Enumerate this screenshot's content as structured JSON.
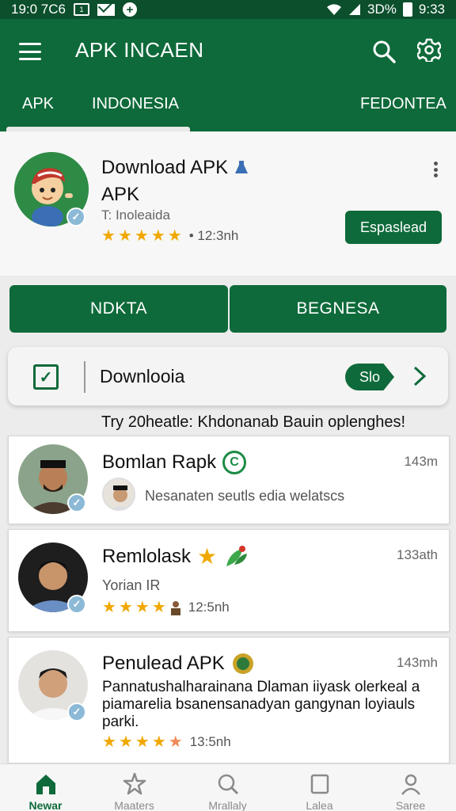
{
  "statusbar": {
    "left_text": "19:0 7C6",
    "box_label": "1",
    "signal_text": "3D%",
    "time": "9:33"
  },
  "appbar": {
    "title": "APK INCAEN",
    "tabs": [
      {
        "label": "APK"
      },
      {
        "label": "INDONESIA"
      },
      {
        "label": "FEDONTEA"
      }
    ]
  },
  "featured": {
    "title": "Download APK",
    "subtitle": "APK",
    "developer": "T: Inoleaida",
    "rating_stars": 5,
    "rating_meta": "• 12:3nh",
    "install_label": "Espaslead"
  },
  "actions": {
    "left_label": "NDKTA",
    "right_label": "BEGNESA"
  },
  "download_bar": {
    "label": "Downlooia",
    "pill_label": "Slo"
  },
  "promo_text": "Try 20heatle: Khdonanab Bauin oplenghes!",
  "cards": [
    {
      "title": "Bomlan Rapk",
      "time": "143m",
      "text": "Nesanaten seutls edia welatscs",
      "badge": "C"
    },
    {
      "title": "Remlolask",
      "time": "133ath",
      "text": "Yorian IR",
      "rating_meta": "12:5nh"
    },
    {
      "title": "Penulead APK",
      "time": "143mh",
      "text_lines": [
        "Pannatushalharainana Dlaman iiyask olerkeal a",
        "piamarelia bsanensanadyan gangynan loyiauls",
        "parki."
      ],
      "rating_meta": "13:5nh"
    }
  ],
  "bottom_nav": [
    {
      "label": "Newar",
      "icon": "home-icon"
    },
    {
      "label": "Maaters",
      "icon": "star-burst-icon"
    },
    {
      "label": "Mrallaly",
      "icon": "search-icon"
    },
    {
      "label": "Lalea",
      "icon": "square-icon"
    },
    {
      "label": "Saree",
      "icon": "person-icon"
    }
  ],
  "colors": {
    "primary": "#0e6a3a",
    "status_bar": "#0b4f2c",
    "star": "#f0a800"
  }
}
